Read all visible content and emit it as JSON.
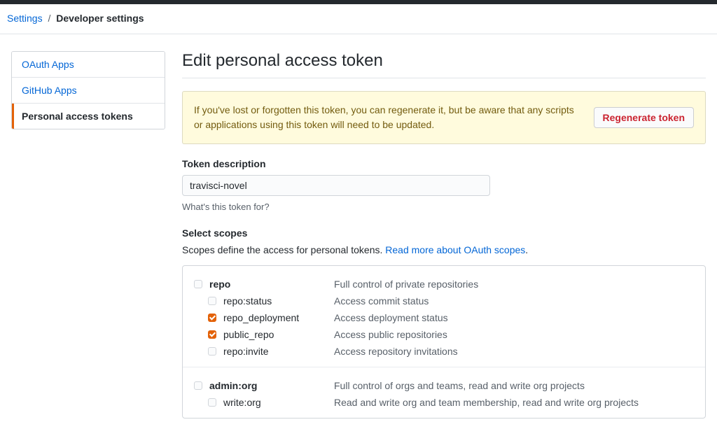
{
  "breadcrumb": {
    "parent": "Settings",
    "sep": "/",
    "current": "Developer settings"
  },
  "sidenav": {
    "items": [
      {
        "label": "OAuth Apps",
        "selected": false
      },
      {
        "label": "GitHub Apps",
        "selected": false
      },
      {
        "label": "Personal access tokens",
        "selected": true
      }
    ]
  },
  "page_title": "Edit personal access token",
  "flash": {
    "text": "If you've lost or forgotten this token, you can regenerate it, but be aware that any scripts or applications using this token will need to be updated.",
    "button": "Regenerate token"
  },
  "token_description": {
    "label": "Token description",
    "value": "travisci-novel",
    "help": "What's this token for?"
  },
  "scopes": {
    "heading": "Select scopes",
    "desc_pre": "Scopes define the access for personal tokens. ",
    "desc_link": "Read more about OAuth scopes",
    "desc_post": ".",
    "groups": [
      {
        "parent": {
          "name": "repo",
          "desc": "Full control of private repositories",
          "checked": false
        },
        "children": [
          {
            "name": "repo:status",
            "desc": "Access commit status",
            "checked": false
          },
          {
            "name": "repo_deployment",
            "desc": "Access deployment status",
            "checked": true
          },
          {
            "name": "public_repo",
            "desc": "Access public repositories",
            "checked": true
          },
          {
            "name": "repo:invite",
            "desc": "Access repository invitations",
            "checked": false
          }
        ]
      },
      {
        "parent": {
          "name": "admin:org",
          "desc": "Full control of orgs and teams, read and write org projects",
          "checked": false
        },
        "children": [
          {
            "name": "write:org",
            "desc": "Read and write org and team membership, read and write org projects",
            "checked": false
          }
        ]
      }
    ]
  }
}
